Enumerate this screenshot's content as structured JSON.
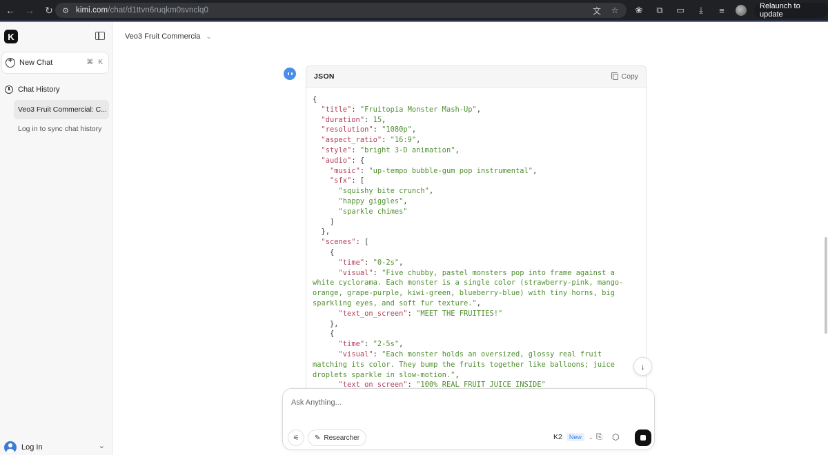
{
  "browser": {
    "url_host": "kimi.com",
    "url_path": "/chat/d1ttvn6ruqkm0svnclq0",
    "relaunch_label": "Relaunch to update"
  },
  "sidebar": {
    "logo_letter": "K",
    "new_chat_label": "New Chat",
    "new_chat_shortcut_mod": "⌘",
    "new_chat_shortcut_key": "K",
    "history_label": "Chat History",
    "history_items": [
      {
        "label": "Veo3 Fruit Commercial: C..."
      }
    ],
    "sync_text": "Log in to sync chat history",
    "login_label": "Log In"
  },
  "main": {
    "chat_title": "Veo3 Fruit Commercia",
    "code_block": {
      "language": "JSON",
      "copy_label": "Copy"
    }
  },
  "composer": {
    "placeholder": "Ask Anything...",
    "researcher_label": "Researcher",
    "model_label": "K2",
    "model_badge": "New"
  }
}
